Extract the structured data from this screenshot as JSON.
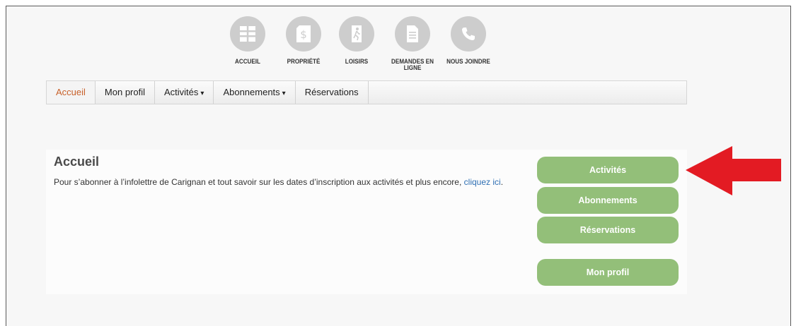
{
  "top_icons": [
    {
      "label": "ACCUEIL",
      "icon": "building-icon"
    },
    {
      "label": "PROPRIÉTÉ",
      "icon": "tax-document-icon"
    },
    {
      "label": "LOISIRS",
      "icon": "runner-icon"
    },
    {
      "label": "DEMANDES EN LIGNE",
      "icon": "document-icon"
    },
    {
      "label": "NOUS JOINDRE",
      "icon": "phone-icon"
    }
  ],
  "navbar": {
    "items": [
      {
        "label": "Accueil",
        "active": true,
        "dropdown": false
      },
      {
        "label": "Mon profil",
        "active": false,
        "dropdown": false
      },
      {
        "label": "Activités",
        "active": false,
        "dropdown": true
      },
      {
        "label": "Abonnements",
        "active": false,
        "dropdown": true
      },
      {
        "label": "Réservations",
        "active": false,
        "dropdown": false
      }
    ],
    "caret": "▾"
  },
  "main": {
    "title": "Accueil",
    "intro_text": "Pour s’abonner à l’infolettre de Carignan et tout savoir sur les dates d’inscription aux activités et plus encore, ",
    "intro_link": "cliquez ici",
    "intro_end": "."
  },
  "side_buttons": {
    "activities": "Activités",
    "subscriptions": "Abonnements",
    "reservations": "Réservations",
    "profile": "Mon profil"
  },
  "colors": {
    "accent_active_nav": "#c8612a",
    "button_green": "#93bf79",
    "icon_circle": "#cdcdcd",
    "link": "#2e6fb3",
    "annotation_arrow": "#e31b23"
  }
}
